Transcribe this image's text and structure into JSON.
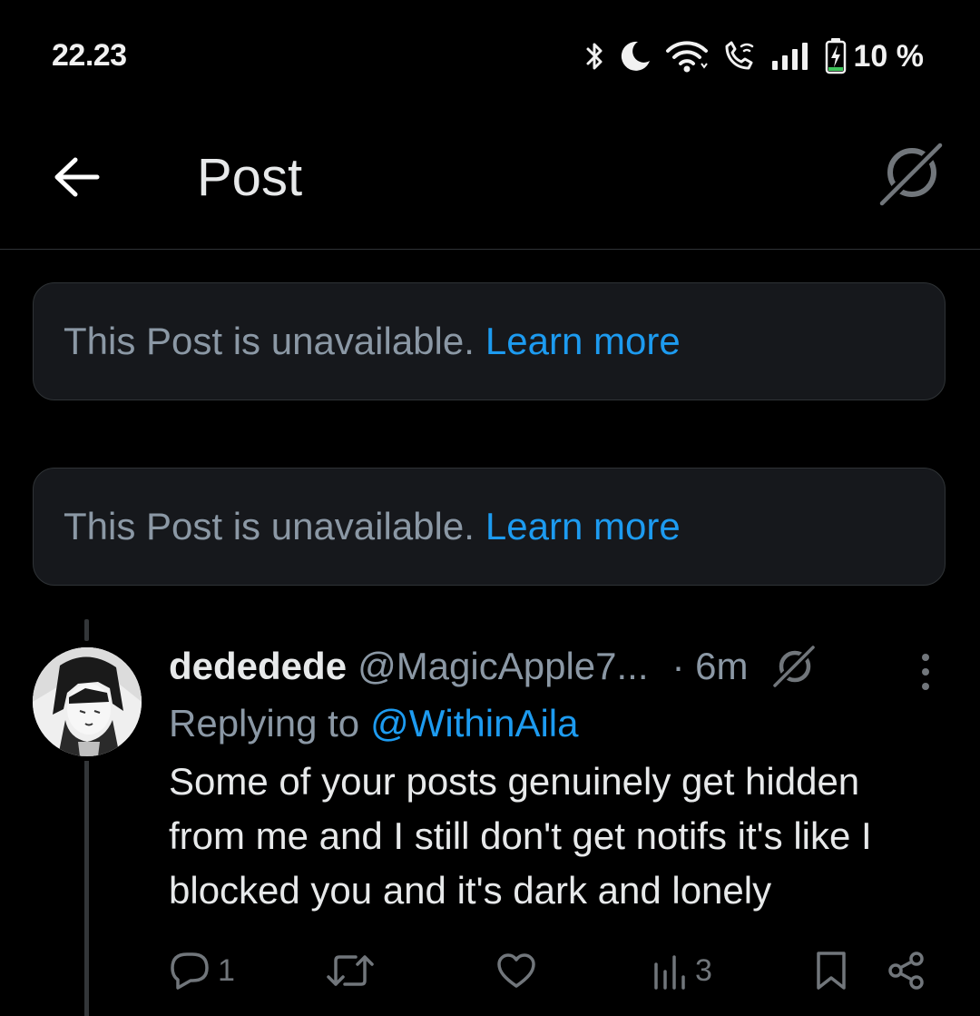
{
  "status_bar": {
    "time": "22.23",
    "battery": "10 %",
    "icons": [
      "bluetooth-icon",
      "moon-icon",
      "wifi-icon",
      "wifi-calling-icon",
      "signal-icon",
      "battery-charging-icon"
    ]
  },
  "header": {
    "title": "Post",
    "back_icon": "arrow-left-icon",
    "grok_icon": "grok-icon"
  },
  "unavailable_cards": [
    {
      "message": "This Post is unavailable.",
      "link": "Learn more"
    },
    {
      "message": "This Post is unavailable.",
      "link": "Learn more"
    }
  ],
  "reply": {
    "display_name": "dededede",
    "handle": "@MagicApple7...",
    "time": "· 6m",
    "replying_label": "Replying to",
    "replying_to": "@WithinAila",
    "text": "Some of your posts genuinely get hidden from me and I still don't get notifs it's like I blocked you and it's dark and lonely",
    "actions": {
      "replies": "1",
      "reposts": "",
      "likes": "",
      "views": "3"
    }
  },
  "colors": {
    "background": "#000000",
    "text": "#e7e9ea",
    "muted": "#8b98a5",
    "link": "#1d9bf0",
    "card": "#16181c",
    "border": "#2f3336",
    "battery_fill": "#3ec45a"
  }
}
